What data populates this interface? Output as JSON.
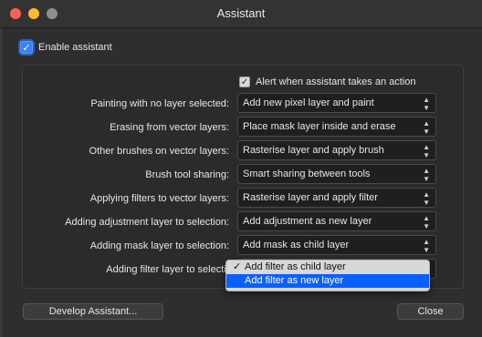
{
  "window": {
    "title": "Assistant"
  },
  "enable_assistant": {
    "label": "Enable assistant",
    "checked": true
  },
  "alert": {
    "label": "Alert when assistant takes an action",
    "checked": true
  },
  "rows": [
    {
      "label": "Painting with no layer selected:",
      "value": "Add new pixel layer and paint"
    },
    {
      "label": "Erasing from vector layers:",
      "value": "Place mask layer inside and erase"
    },
    {
      "label": "Other brushes on vector layers:",
      "value": "Rasterise layer and apply brush"
    },
    {
      "label": "Brush tool sharing:",
      "value": "Smart sharing between tools"
    },
    {
      "label": "Applying filters to vector layers:",
      "value": "Rasterise layer and apply filter"
    },
    {
      "label": "Adding adjustment layer to selection:",
      "value": "Add adjustment as new layer"
    },
    {
      "label": "Adding mask layer to selection:",
      "value": "Add mask as child layer"
    },
    {
      "label": "Adding filter layer to selection:",
      "value": ""
    }
  ],
  "dropdown": {
    "options": [
      {
        "label": "Add filter as child layer",
        "checked": true,
        "check_glyph": "✓"
      },
      {
        "label": "Add filter as new layer",
        "highlighted": true
      }
    ]
  },
  "buttons": {
    "develop": "Develop Assistant...",
    "close": "Close"
  },
  "colors": {
    "accent": "#0a60ff",
    "checkbox": "#3b82f6"
  }
}
